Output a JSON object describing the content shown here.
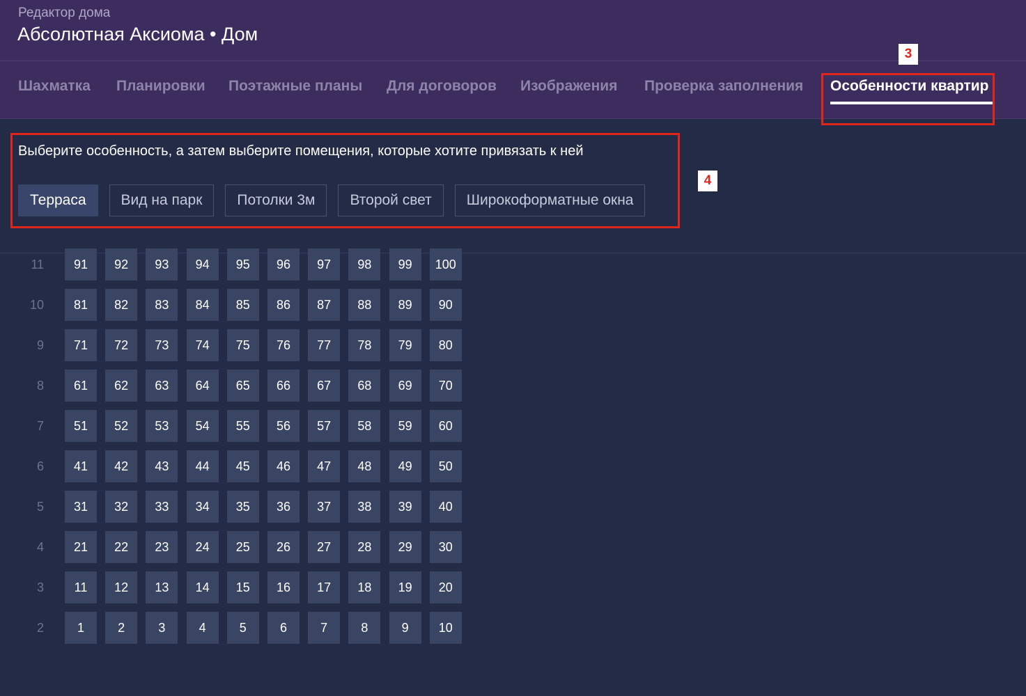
{
  "header": {
    "subtitle": "Редактор дома",
    "title": "Абсолютная Аксиома • Дом"
  },
  "tabs": [
    {
      "label": "Шахматка",
      "active": false
    },
    {
      "label": "Планировки",
      "active": false
    },
    {
      "label": "Поэтажные планы",
      "active": false
    },
    {
      "label": "Для договоров",
      "active": false
    },
    {
      "label": "Изображения",
      "active": false
    },
    {
      "label": "Проверка заполнения",
      "active": false
    },
    {
      "label": "Особенности квартир",
      "active": true
    }
  ],
  "annotations": {
    "tab_marker": "3",
    "features_marker": "4",
    "color": "#e2251b"
  },
  "features": {
    "instruction": "Выберите особенность, а затем выберите помещения, которые хотите привязать к ней",
    "buttons": [
      {
        "label": "Терраса",
        "active": true
      },
      {
        "label": "Вид на парк",
        "active": false
      },
      {
        "label": "Потолки 3м",
        "active": false
      },
      {
        "label": "Второй свет",
        "active": false
      },
      {
        "label": "Широкоформатные окна",
        "active": false
      }
    ]
  },
  "floors": [
    {
      "floor": "11",
      "units": [
        "91",
        "92",
        "93",
        "94",
        "95",
        "96",
        "97",
        "98",
        "99",
        "100"
      ]
    },
    {
      "floor": "10",
      "units": [
        "81",
        "82",
        "83",
        "84",
        "85",
        "86",
        "87",
        "88",
        "89",
        "90"
      ]
    },
    {
      "floor": "9",
      "units": [
        "71",
        "72",
        "73",
        "74",
        "75",
        "76",
        "77",
        "78",
        "79",
        "80"
      ]
    },
    {
      "floor": "8",
      "units": [
        "61",
        "62",
        "63",
        "64",
        "65",
        "66",
        "67",
        "68",
        "69",
        "70"
      ]
    },
    {
      "floor": "7",
      "units": [
        "51",
        "52",
        "53",
        "54",
        "55",
        "56",
        "57",
        "58",
        "59",
        "60"
      ]
    },
    {
      "floor": "6",
      "units": [
        "41",
        "42",
        "43",
        "44",
        "45",
        "46",
        "47",
        "48",
        "49",
        "50"
      ]
    },
    {
      "floor": "5",
      "units": [
        "31",
        "32",
        "33",
        "34",
        "35",
        "36",
        "37",
        "38",
        "39",
        "40"
      ]
    },
    {
      "floor": "4",
      "units": [
        "21",
        "22",
        "23",
        "24",
        "25",
        "26",
        "27",
        "28",
        "29",
        "30"
      ]
    },
    {
      "floor": "3",
      "units": [
        "11",
        "12",
        "13",
        "14",
        "15",
        "16",
        "17",
        "18",
        "19",
        "20"
      ]
    },
    {
      "floor": "2",
      "units": [
        "1",
        "2",
        "3",
        "4",
        "5",
        "6",
        "7",
        "8",
        "9",
        "10"
      ]
    }
  ]
}
